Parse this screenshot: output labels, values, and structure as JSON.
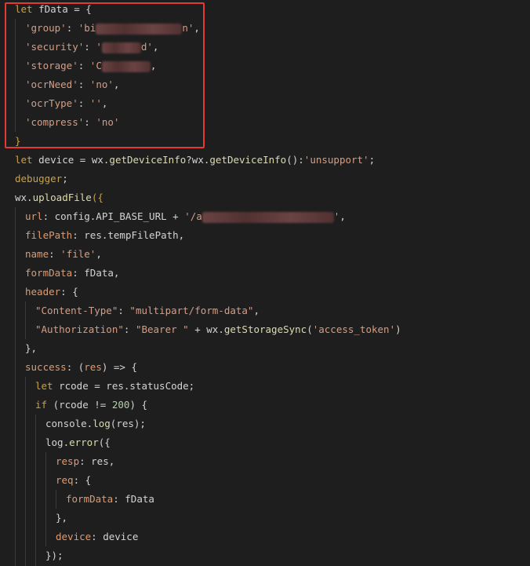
{
  "code": {
    "l1": {
      "kw": "let",
      "a": " fData = {"
    },
    "l2": {
      "key": "'group'",
      "colon": ": ",
      "val_start": "'bi",
      "val_end": "n'",
      "comma": ","
    },
    "l3": {
      "key": "'security'",
      "colon": ": ",
      "val_start": "'",
      "val_end": "d'",
      "comma": ","
    },
    "l4": {
      "key": "'storage'",
      "colon": ": ",
      "val_start": "'C",
      "val_end": "",
      "comma": ","
    },
    "l5": {
      "key": "'ocrNeed'",
      "colon": ": ",
      "val": "'no'",
      "comma": ","
    },
    "l6": {
      "key": "'ocrType'",
      "colon": ": ",
      "val": "''",
      "comma": ","
    },
    "l7": {
      "key": "'compress'",
      "colon": ": ",
      "val": "'no'"
    },
    "l8": {
      "brace": "}"
    },
    "l9": {
      "kw": "let",
      "a": " device = wx.",
      "fn1": "getDeviceInfo",
      "b": "?wx.",
      "fn2": "getDeviceInfo",
      "c": "():",
      "str": "'unsupport'",
      "d": ";"
    },
    "l10": {
      "kw": "debugger",
      "a": ";"
    },
    "l11": {
      "a": "wx.",
      "fn": "uploadFile",
      "b": "({"
    },
    "l12": {
      "prop": "url",
      "a": ": config.API_BASE_URL + ",
      "str_start": "'/a",
      "str_end": "'",
      "b": ","
    },
    "l13": {
      "prop": "filePath",
      "a": ": res.tempFilePath,"
    },
    "l14": {
      "prop": "name",
      "a": ": ",
      "str": "'file'",
      "b": ","
    },
    "l15": {
      "prop": "formData",
      "a": ": fData,"
    },
    "l16": {
      "prop": "header",
      "a": ": {"
    },
    "l17": {
      "str1": "\"Content-Type\"",
      "a": ": ",
      "str2": "\"multipart/form-data\"",
      "b": ","
    },
    "l18": {
      "str1": "\"Authorization\"",
      "a": ": ",
      "str2": "\"Bearer \"",
      "b": " + wx.",
      "fn": "getStorageSync",
      "c": "(",
      "str3": "'access_token'",
      "d": ")"
    },
    "l19": {
      "a": "},"
    },
    "l20": {
      "prop": "success",
      "a": ": (",
      "b": "res",
      "c": ") => {"
    },
    "l21": {
      "kw": "let",
      "a": " rcode = res.statusCode;"
    },
    "l22": {
      "kw": "if",
      "a": " (rcode != ",
      "num": "200",
      "b": ") {"
    },
    "l23": {
      "a": "console.",
      "fn": "log",
      "b": "(res);"
    },
    "l24": {
      "a": "log.",
      "fn": "error",
      "b": "({"
    },
    "l25": {
      "prop": "resp",
      "a": ": res,"
    },
    "l26": {
      "prop": "req",
      "a": ": {"
    },
    "l27": {
      "prop": "formData",
      "a": ": fData"
    },
    "l28": {
      "a": "},"
    },
    "l29": {
      "prop": "device",
      "a": ": device"
    },
    "l30": {
      "a": "});"
    }
  }
}
